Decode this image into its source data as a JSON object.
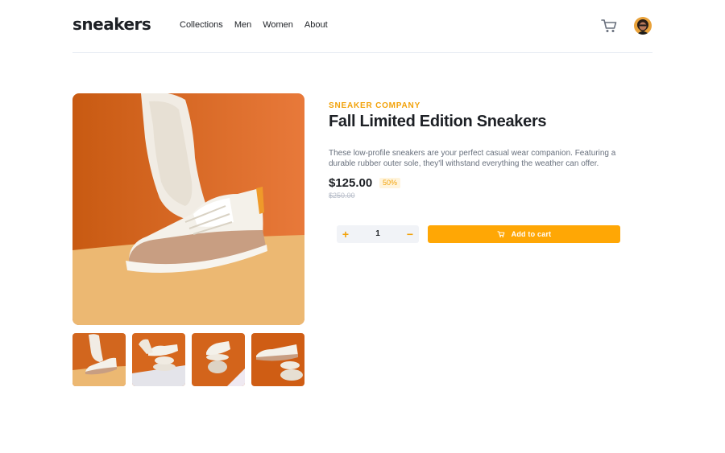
{
  "brand": {
    "logo": "sneakers"
  },
  "nav": {
    "items": [
      {
        "label": "Collections"
      },
      {
        "label": "Men"
      },
      {
        "label": "Women"
      },
      {
        "label": "About"
      }
    ]
  },
  "header_icons": {
    "cart": "cart-icon",
    "avatar": "user-avatar"
  },
  "product": {
    "company": "SNEAKER COMPANY",
    "title": "Fall Limited Edition Sneakers",
    "description": "These low-profile sneakers are your perfect casual wear companion. Featuring a durable rubber outer sole, they'll withstand everything the weather can offer.",
    "price": "$125.00",
    "discount": "50%",
    "original_price": "$250.00"
  },
  "quantity": {
    "plus_label": "+",
    "value": "1",
    "minus_label": "−"
  },
  "cart_button": {
    "label": "Add to cart",
    "icon": "cart-icon"
  },
  "colors": {
    "accent": "#ffa705",
    "accent_text": "#f2a20a",
    "dark": "#1d2025",
    "muted": "#68707d",
    "badge_bg": "#fff4dc"
  }
}
